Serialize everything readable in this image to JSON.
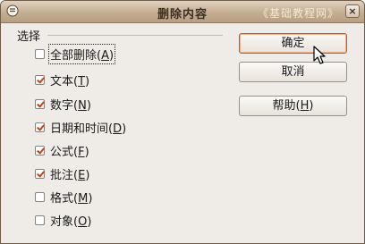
{
  "window": {
    "title": "删除内容",
    "watermark": "《基础教程网》",
    "close_label": "×"
  },
  "group": {
    "label": "选择"
  },
  "options": [
    {
      "text": "全部删除",
      "key": "A",
      "checked": false
    },
    {
      "text": "文本",
      "key": "T",
      "checked": true
    },
    {
      "text": "数字",
      "key": "N",
      "checked": true
    },
    {
      "text": "日期和时间",
      "key": "D",
      "checked": true
    },
    {
      "text": "公式",
      "key": "F",
      "checked": true
    },
    {
      "text": "批注",
      "key": "E",
      "checked": true
    },
    {
      "text": "格式",
      "key": "M",
      "checked": false
    },
    {
      "text": "对象",
      "key": "O",
      "checked": false
    }
  ],
  "buttons": {
    "ok_label": "确定",
    "cancel_label": "取消",
    "help_text": "帮助",
    "help_key": "H"
  },
  "colors": {
    "title_bar": "#c5ad92",
    "check_mark": "#c0431a",
    "default_button_border": "#c25a2a"
  }
}
